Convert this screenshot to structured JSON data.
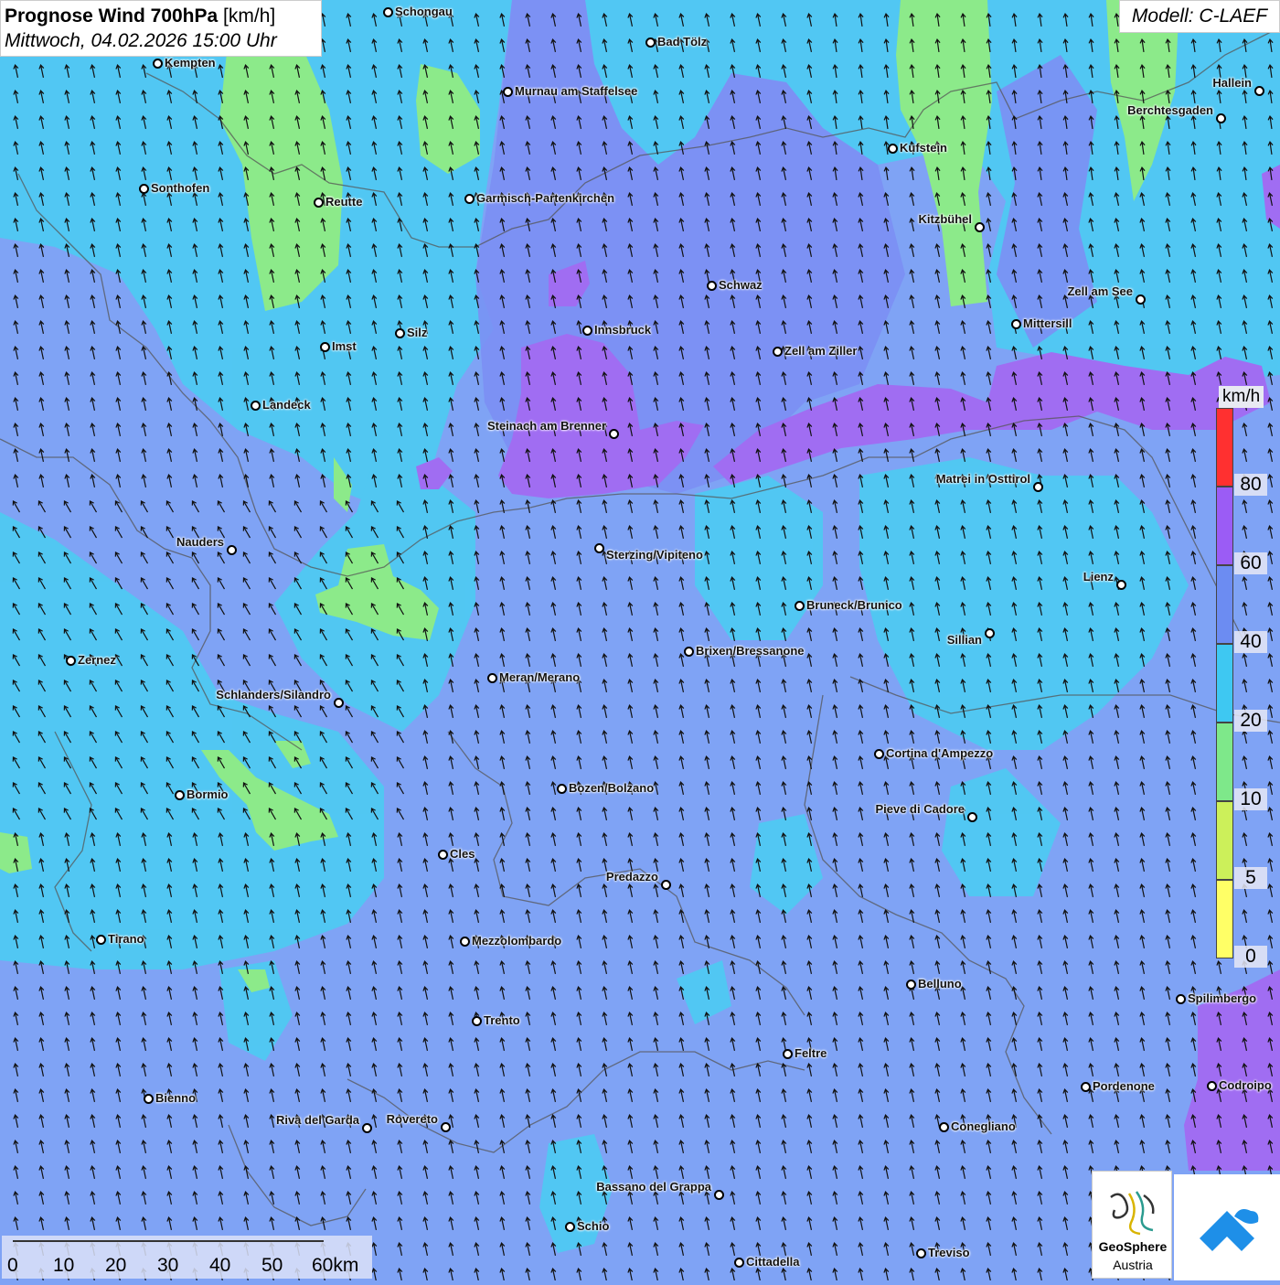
{
  "title": {
    "main_bold": "Prognose Wind 700hPa",
    "main_unit": "[km/h]",
    "datetime": "Mittwoch, 04.02.2026 15:00 Uhr"
  },
  "model_label": "Modell: C-LAEF",
  "legend": {
    "unit": "km/h",
    "labels": [
      "80",
      "60",
      "40",
      "20",
      "10",
      "5",
      "0"
    ],
    "colors": [
      "#ff3030",
      "#9b5cf5",
      "#6c8cf2",
      "#3ec8f2",
      "#7ee88a",
      "#ccf05a",
      "#ffff66"
    ]
  },
  "scale_bar": {
    "labels": [
      "0",
      "10",
      "20",
      "30",
      "40",
      "50",
      "60km"
    ]
  },
  "logo": {
    "name_line1": "GeoSphere",
    "name_line2": "Austria"
  },
  "colors": {
    "base": "#7fa3f5",
    "cyan_zone": "#4fc9f2",
    "green_zone": "#8cea8a",
    "purple_zone": "#a06df2",
    "arrow": "#111111"
  },
  "cities": [
    {
      "name": "Schongau"
    },
    {
      "name": "Bad Tölz"
    },
    {
      "name": "Kempten"
    },
    {
      "name": "Murnau am Staffelsee"
    },
    {
      "name": "Hallein"
    },
    {
      "name": "Berchtesgaden"
    },
    {
      "name": "Kufstein"
    },
    {
      "name": "Sonthofen"
    },
    {
      "name": "Reutte"
    },
    {
      "name": "Garmisch-Partenkirchen"
    },
    {
      "name": "Kitzbühel"
    },
    {
      "name": "Schwaz"
    },
    {
      "name": "Zell am See"
    },
    {
      "name": "Mittersill"
    },
    {
      "name": "Innsbruck"
    },
    {
      "name": "Silz"
    },
    {
      "name": "Imst"
    },
    {
      "name": "Zell am Ziller"
    },
    {
      "name": "Landeck"
    },
    {
      "name": "Steinach am Brenner"
    },
    {
      "name": "Matrei in Osttirol"
    },
    {
      "name": "Nauders"
    },
    {
      "name": "Sterzing/Vipiteno"
    },
    {
      "name": "Lienz"
    },
    {
      "name": "Bruneck/Brunico"
    },
    {
      "name": "Sillian"
    },
    {
      "name": "Brixen/Bressanone"
    },
    {
      "name": "Zernez"
    },
    {
      "name": "Meran/Merano"
    },
    {
      "name": "Schlanders/Silandro"
    },
    {
      "name": "Cortina d'Ampezzo"
    },
    {
      "name": "Bozen/Bolzano"
    },
    {
      "name": "Bormio"
    },
    {
      "name": "Pieve di Cadore"
    },
    {
      "name": "Cles"
    },
    {
      "name": "Predazzo"
    },
    {
      "name": "Tirano"
    },
    {
      "name": "Mezzolombardo"
    },
    {
      "name": "Belluno"
    },
    {
      "name": "Spilimbergo"
    },
    {
      "name": "Trento"
    },
    {
      "name": "Feltre"
    },
    {
      "name": "Pordenone"
    },
    {
      "name": "Codroipo"
    },
    {
      "name": "Bienno"
    },
    {
      "name": "Riva del Garda"
    },
    {
      "name": "Rovereto"
    },
    {
      "name": "Conegliano"
    },
    {
      "name": "Bassano del Grappa"
    },
    {
      "name": "Schio"
    },
    {
      "name": "Treviso"
    },
    {
      "name": "Cittadella"
    }
  ]
}
